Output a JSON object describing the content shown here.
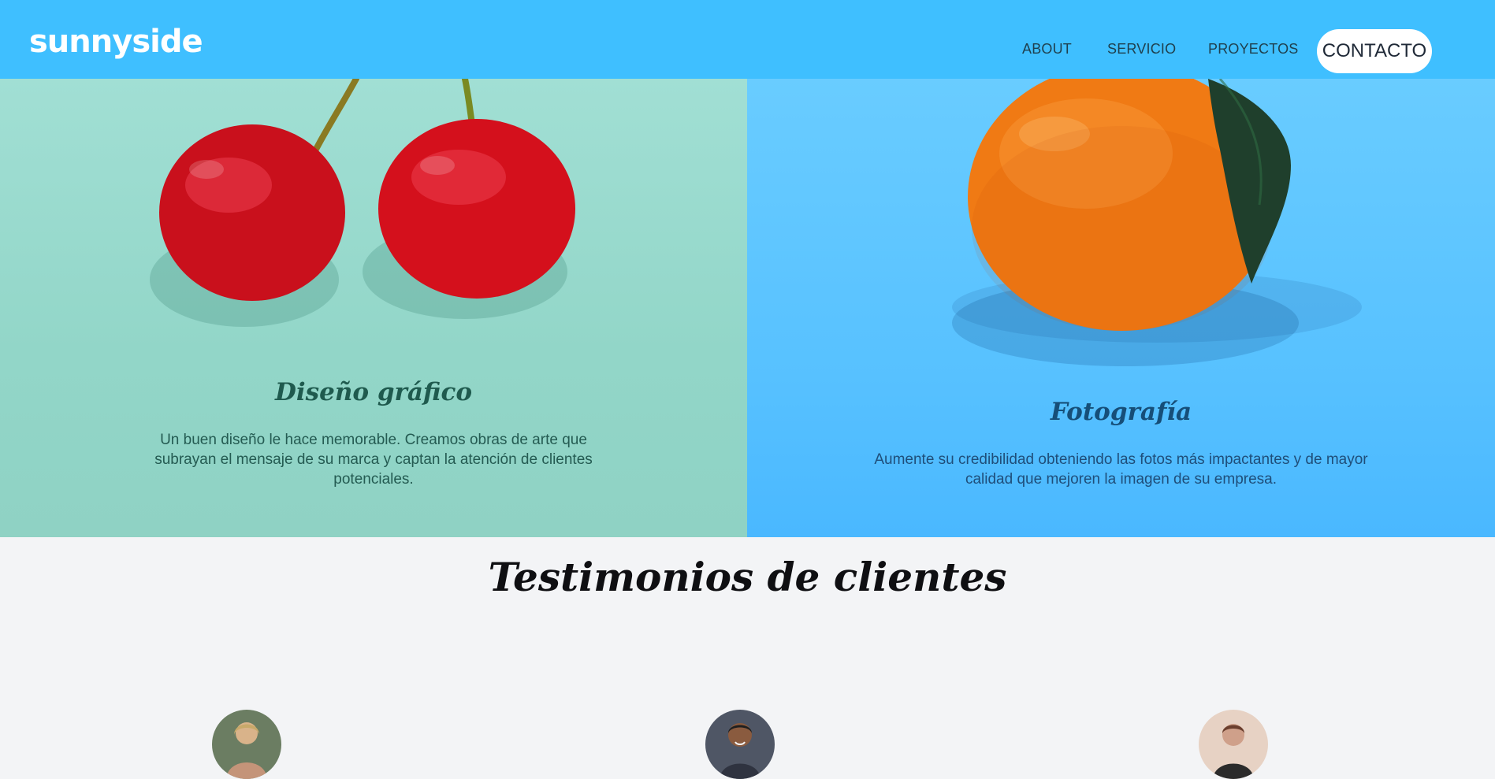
{
  "header": {
    "logo": "sunnyside",
    "nav": {
      "about": "ABOUT",
      "servicio": "SERVICIO",
      "proyectos": "PROYECTOS",
      "contacto": "CONTACTO"
    }
  },
  "services": {
    "graphic_design": {
      "title": "Diseño gráfico",
      "text": "Un buen diseño le hace memorable. Creamos obras de arte que subrayan el mensaje de su marca y captan la atención de clientes potenciales."
    },
    "photography": {
      "title": "Fotografía",
      "text": "Aumente su credibilidad obteniendo las fotos más impactantes y de mayor calidad que mejoren la imagen de su empresa."
    }
  },
  "testimonials": {
    "title": "Testimonios de clientes"
  },
  "colors": {
    "header_bg": "#3fbfff",
    "left_panel_bg": "#9ddbd0",
    "right_panel_bg": "#5fc6ff",
    "page_bg": "#f3f4f6"
  },
  "icons": {
    "left_image": "cherries-image",
    "right_image": "orange-image",
    "avatars": [
      "person-avatar-1",
      "person-avatar-2",
      "person-avatar-3"
    ]
  }
}
